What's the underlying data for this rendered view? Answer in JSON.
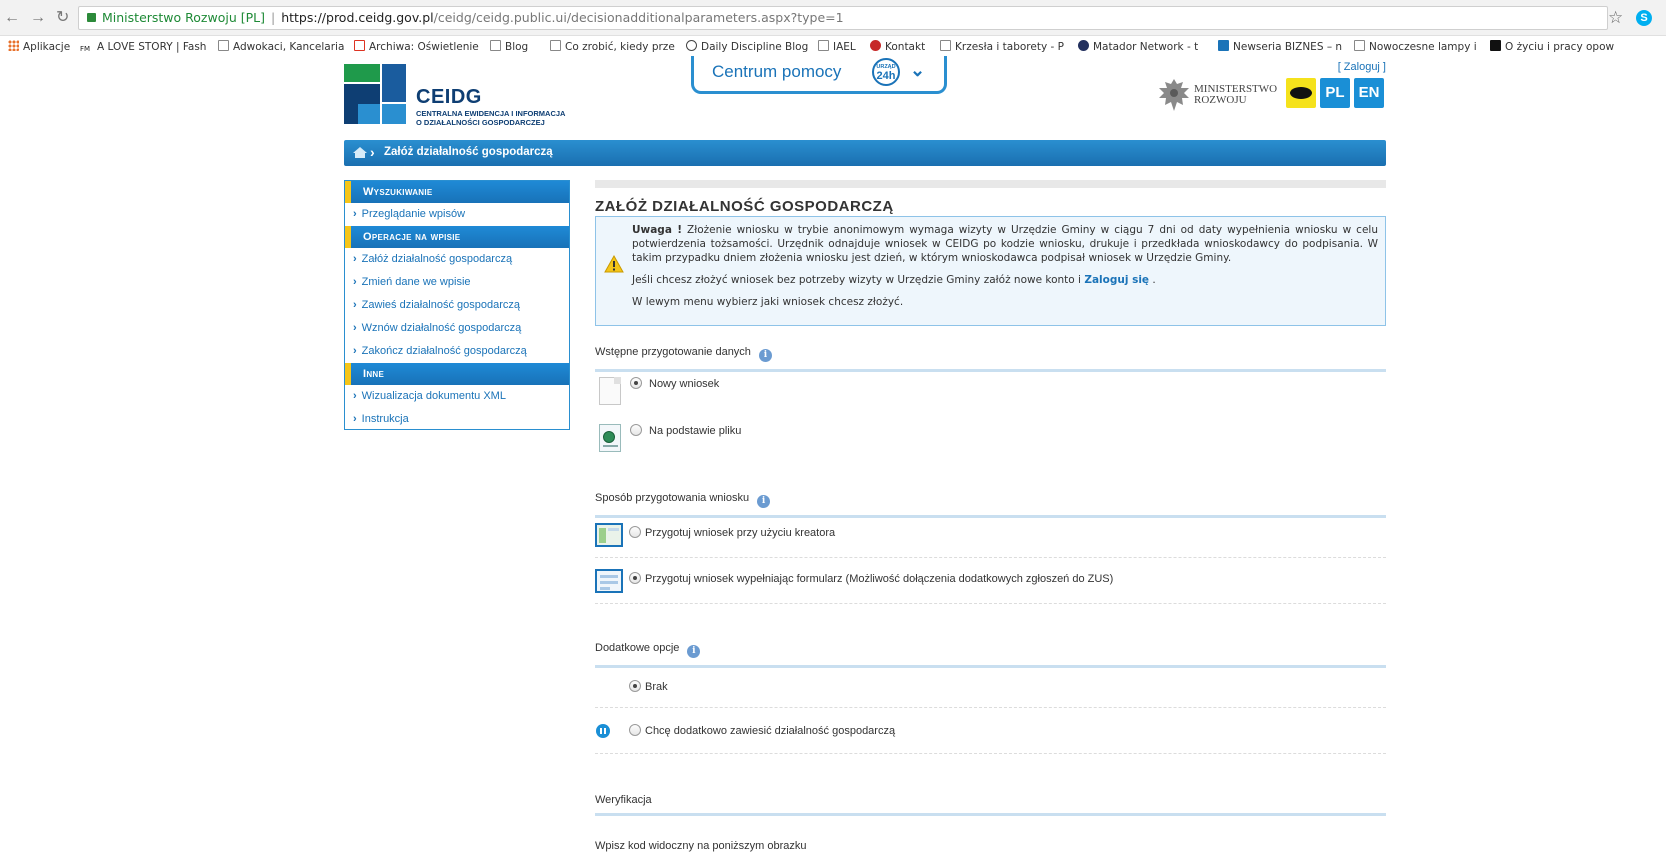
{
  "browser": {
    "site_name": "Ministerstwo Rozwoju [PL]",
    "url_host": "https://prod.ceidg.gov.pl",
    "url_rest": "/ceidg/ceidg.public.ui/decisionadditionalparameters.aspx?type=1",
    "bookmarks": [
      "Aplikacje",
      "A LOVE STORY | Fash",
      "Adwokaci, Kancelaria",
      "Archiwa: Oświetlenie",
      "Blog",
      "Co zrobić, kiedy prze",
      "Daily Discipline Blog",
      "IAEL",
      "Kontakt",
      "Krzesła i taborety - P",
      "Matador Network - t",
      "Newseria BIZNES – n",
      "Nowoczesne lampy i",
      "O życiu i pracy opow"
    ],
    "fm_label": "FM"
  },
  "header": {
    "logo_name": "CEIDG",
    "logo_sub_line1": "CENTRALNA EWIDENCJA I INFORMACJA",
    "logo_sub_line2": "O DZIAŁALNOŚCI GOSPODARCZEJ",
    "help_label": "Centrum pomocy",
    "help_badge_top": "URZĄD",
    "help_badge_main": "24h",
    "login_label": "[ Zaloguj ]",
    "ministry_line1": "MINISTERSTWO",
    "ministry_line2": "ROZWOJU",
    "lang_pl": "PL",
    "lang_en": "EN"
  },
  "breadcrumb": {
    "label": "Załóż działalność gospodarczą"
  },
  "sidebar": {
    "sections": [
      {
        "title": "Wyszukiwanie",
        "items": [
          "Przeglądanie wpisów"
        ]
      },
      {
        "title": "Operacje na wpisie",
        "items": [
          "Załóż działalność gospodarczą",
          "Zmień dane we wpisie",
          "Zawieś działalność gospodarczą",
          "Wznów działalność gospodarczą",
          "Zakończ działalność gospodarczą"
        ]
      },
      {
        "title": "Inne",
        "items": [
          "Wizualizacja dokumentu XML",
          "Instrukcja"
        ]
      }
    ]
  },
  "main": {
    "title": "ZAŁÓŻ DZIAŁALNOŚĆ GOSPODARCZĄ",
    "notice": {
      "bold": "Uwaga !",
      "text1": " Złożenie wniosku w trybie anonimowym wymaga wizyty w Urzędzie Gminy w ciągu 7 dni od daty wypełnienia wniosku w celu potwierdzenia tożsamości. Urzędnik odnajduje wniosek w CEIDG po kodzie wniosku, drukuje i przedkłada wnioskodawcy do podpisania. W takim przypadku dniem złożenia wniosku jest dzień, w którym wnioskodawca podpisał wniosek w Urzędzie Gminy.",
      "text2": "Jeśli chcesz złożyć wniosek bez potrzeby wizyty w Urzędzie Gminy załóż nowe konto i ",
      "link": "Zaloguj się",
      "text2_end": " .",
      "text3": "W lewym menu wybierz jaki wniosek chcesz złożyć."
    },
    "sections": {
      "prep": "Wstępne przygotowanie danych",
      "method": "Sposób przygotowania wniosku",
      "extra": "Dodatkowe opcje",
      "verify": "Weryfikacja"
    },
    "options": {
      "new_app": "Nowy wniosek",
      "from_file": "Na podstawie pliku",
      "wizard": "Przygotuj wniosek przy użyciu kreatora",
      "form": "Przygotuj wniosek wypełniając formularz (Możliwość dołączenia dodatkowych zgłoszeń do ZUS)",
      "none": "Brak",
      "suspend": "Chcę dodatkowo zawiesić działalność gospodarczą"
    },
    "captcha_label": "Wpisz kod widoczny na poniższym obrazku",
    "info_glyph": "i"
  },
  "colors": {
    "accent": "#1a73b8",
    "sidebar_marker": "#f5c518",
    "logo_green": "#1f9a4b"
  }
}
